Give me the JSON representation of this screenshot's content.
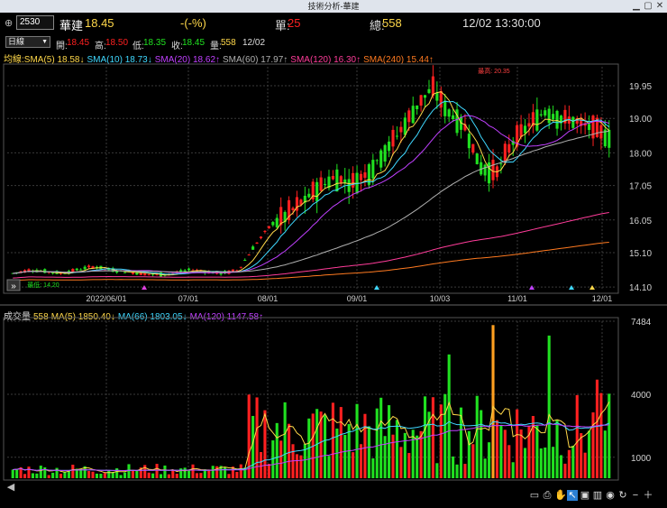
{
  "window": {
    "title": "技術分析-華建"
  },
  "quote": {
    "code": "2530",
    "name": "華建",
    "price": "18.45",
    "change": "-(-%)",
    "single_label": "單:",
    "single_value": "25",
    "total_label": "總:",
    "total_value": "558",
    "datetime": "12/02 13:30:00"
  },
  "ohlc": {
    "period": "日線",
    "open_label": "開:",
    "open": "18.45",
    "high_label": "高:",
    "high": "18.50",
    "low_label": "低:",
    "low": "18.35",
    "close_label": "收:",
    "close": "18.45",
    "vol_label": "量:",
    "vol": "558",
    "date": "12/02"
  },
  "ma_legend": [
    {
      "text": "均線:SMA(5) 18.58↓",
      "color": "#ffd84a"
    },
    {
      "text": "SMA(10) 18.73↓",
      "color": "#3fd8ff"
    },
    {
      "text": "SMA(20) 18.62↑",
      "color": "#c040ff"
    },
    {
      "text": "SMA(60) 17.97↑",
      "color": "#b0b0b0"
    },
    {
      "text": "SMA(120) 16.30↑",
      "color": "#ff3c9a"
    },
    {
      "text": "SMA(240) 15.44↑",
      "color": "#ff7a20"
    }
  ],
  "vol_legend": [
    {
      "text": "成交量",
      "color": "#dddddd"
    },
    {
      "text": "558",
      "color": "#ffd84a"
    },
    {
      "text": "MA(5) 1850.40↓",
      "color": "#ffd84a"
    },
    {
      "text": "MA(66) 1803.05↓",
      "color": "#3fd8ff"
    },
    {
      "text": "MA(120) 1147.58↑",
      "color": "#c040ff"
    }
  ],
  "price_axis": [
    "19.95",
    "19.00",
    "18.00",
    "17.05",
    "16.05",
    "15.10",
    "14.10"
  ],
  "vol_axis": [
    "7484",
    "4000",
    "1000"
  ],
  "date_axis": [
    "2022/06/01",
    "07/01",
    "08/01",
    "09/01",
    "10/03",
    "11/01",
    "12/01"
  ],
  "annotations": {
    "high_mark": "最高: 20.35",
    "low_mark": "最低: 14.20"
  },
  "colors": {
    "up": "#ff2020",
    "down": "#20e020",
    "grid": "#3a3a3a",
    "axis_text": "#d0d0d0"
  },
  "chart_data": {
    "type": "candlestick",
    "price_range": [
      14.0,
      20.5
    ],
    "volume_max": 7484,
    "overview": "daily candles from 2022/05 to 2022/12/02; price near 14.5 until late Aug, rally to 20.35 in Oct, close 18.45",
    "sample_closes": [
      14.5,
      14.6,
      14.55,
      14.5,
      14.6,
      14.7,
      14.6,
      14.55,
      14.5,
      14.45,
      14.5,
      14.6,
      14.55,
      14.5,
      14.6,
      15.3,
      15.9,
      16.2,
      16.6,
      17.0,
      17.3,
      17.1,
      17.4,
      18.0,
      18.6,
      19.3,
      19.9,
      19.2,
      18.8,
      17.6,
      17.4,
      18.3,
      18.8,
      19.2,
      19.0,
      18.9,
      18.7,
      18.45
    ]
  }
}
